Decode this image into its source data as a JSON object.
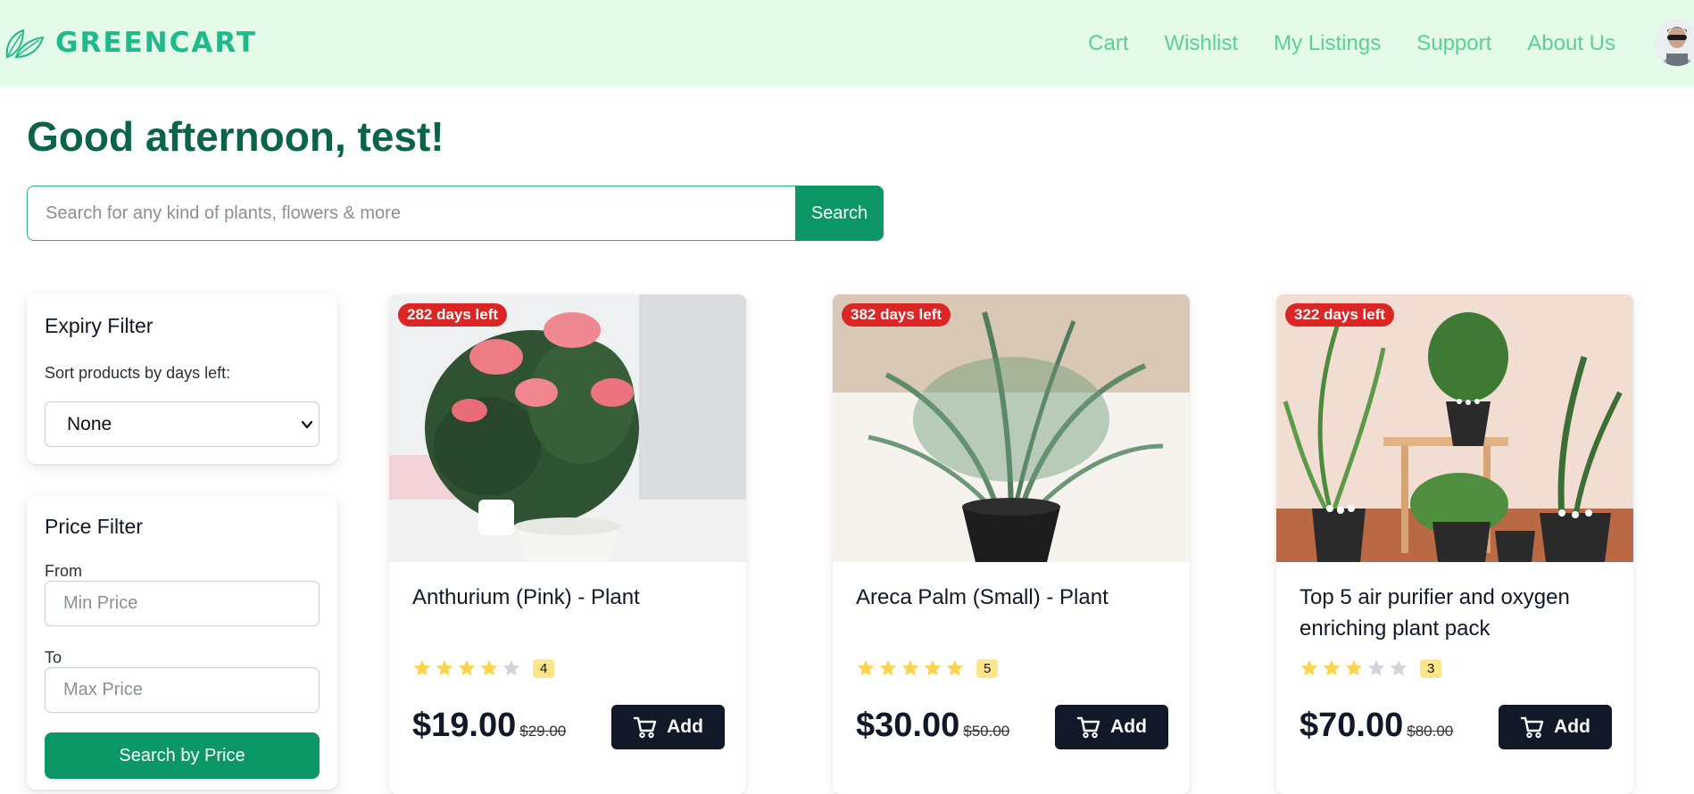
{
  "nav": {
    "brand": "GREENCART",
    "links": [
      "Cart",
      "Wishlist",
      "My Listings",
      "Support",
      "About Us"
    ],
    "colors": {
      "background": "#e5fbea",
      "brand": "#1fb98a",
      "link": "#5ccf92"
    }
  },
  "header": {
    "greeting": "Good afternoon, test!",
    "search_placeholder": "Search for any kind of plants, flowers & more",
    "search_value": "",
    "search_button": "Search"
  },
  "filters": {
    "expiry": {
      "title": "Expiry Filter",
      "label": "Sort products by days left:",
      "selected": "None"
    },
    "price": {
      "title": "Price Filter",
      "from_label": "From",
      "from_placeholder": "Min Price",
      "to_label": "To",
      "to_placeholder": "Max Price",
      "button": "Search by Price"
    }
  },
  "products": [
    {
      "badge": "282 days left",
      "title": "Anthurium (Pink) - Plant",
      "rating": 4,
      "rating_label": "4",
      "price": "$19.00",
      "old_price": "$29.00",
      "add_label": "Add"
    },
    {
      "badge": "382 days left",
      "title": "Areca Palm (Small) - Plant",
      "rating": 5,
      "rating_label": "5",
      "price": "$30.00",
      "old_price": "$50.00",
      "add_label": "Add"
    },
    {
      "badge": "322 days left",
      "title": "Top 5 air purifier and oxygen enriching plant pack",
      "rating": 3,
      "rating_label": "3",
      "price": "$70.00",
      "old_price": "$80.00",
      "add_label": "Add"
    }
  ],
  "colors": {
    "accent": "#0c9866",
    "heading": "#0b6448",
    "badge": "#dc2626",
    "star": "#fcd34d",
    "button_dark": "#111827"
  }
}
